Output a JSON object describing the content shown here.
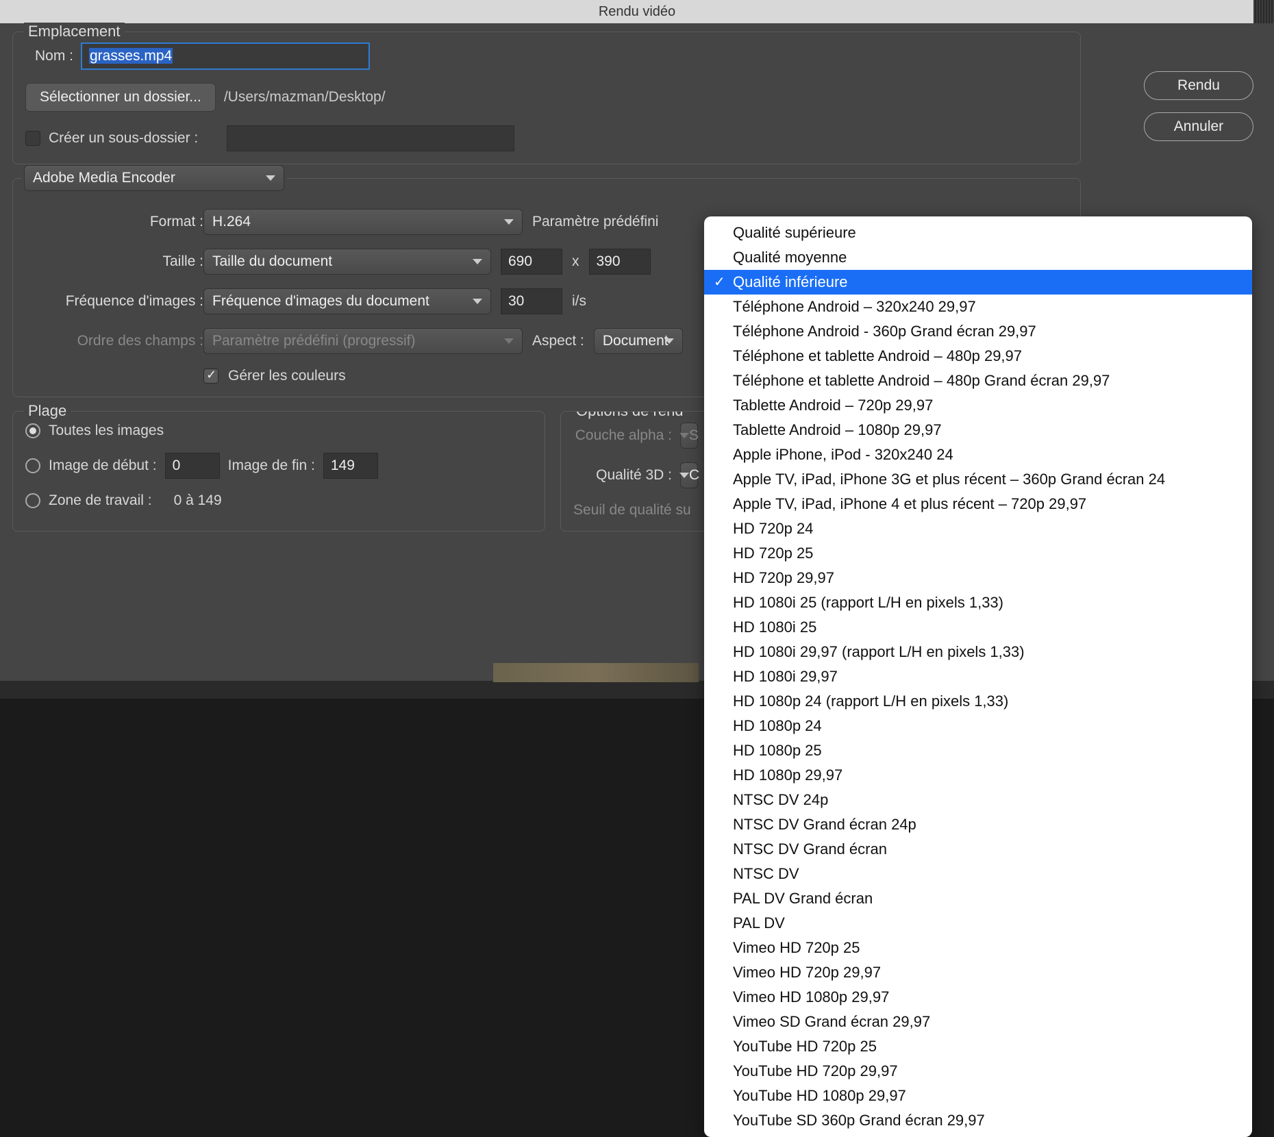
{
  "titlebar": "Rendu vidéo",
  "buttons": {
    "render": "Rendu",
    "cancel": "Annuler"
  },
  "location": {
    "legend": "Emplacement",
    "name_label": "Nom :",
    "name_value": "grasses.mp4",
    "select_folder": "Sélectionner un dossier...",
    "path": "/Users/mazman/Desktop/",
    "create_subfolder": "Créer un sous-dossier :",
    "subfolder_value": ""
  },
  "encoder": {
    "selected": "Adobe Media Encoder",
    "format_label": "Format :",
    "format_value": "H.264",
    "preset_label": "Paramètre prédéfini",
    "size_label": "Taille :",
    "size_select": "Taille du document",
    "width": "690",
    "x": "x",
    "height": "390",
    "fps_label": "Fréquence d'images :",
    "fps_select": "Fréquence d'images du document",
    "fps_value": "30",
    "fps_unit": "i/s",
    "fieldorder_label": "Ordre des champs :",
    "fieldorder_value": "Paramètre prédéfini (progressif)",
    "aspect_label": "Aspect :",
    "aspect_value": "Document",
    "manage_colors": "Gérer les couleurs"
  },
  "range": {
    "legend": "Plage",
    "all_frames": "Toutes les images",
    "start_label": "Image de début :",
    "start_value": "0",
    "end_label": "Image de fin :",
    "end_value": "149",
    "workarea_label": "Zone de travail :",
    "workarea_value": "0 à 149"
  },
  "render_options": {
    "legend": "Options de rend",
    "alpha_label": "Couche alpha :",
    "alpha_value_first": "S",
    "quality3d_label": "Qualité 3D :",
    "quality3d_value_first": "C",
    "threshold_label": "Seuil de qualité su"
  },
  "preset_menu": {
    "selected_index": 2,
    "items": [
      "Qualité supérieure",
      "Qualité moyenne",
      "Qualité inférieure",
      "Téléphone Android – 320x240 29,97",
      "Téléphone Android - 360p Grand écran 29,97",
      "Téléphone et tablette Android – 480p 29,97",
      "Téléphone et tablette Android – 480p Grand écran 29,97",
      "Tablette Android – 720p 29,97",
      "Tablette Android – 1080p 29,97",
      "Apple iPhone, iPod - 320x240 24",
      "Apple TV, iPad, iPhone 3G et plus récent – 360p Grand écran 24",
      "Apple TV, iPad, iPhone 4 et plus récent – 720p 29,97",
      "HD 720p 24",
      "HD 720p 25",
      "HD 720p 29,97",
      "HD 1080i 25 (rapport L/H en pixels 1,33)",
      "HD 1080i 25",
      "HD 1080i 29,97 (rapport L/H en pixels 1,33)",
      "HD 1080i 29,97",
      "HD 1080p 24 (rapport L/H en pixels 1,33)",
      "HD 1080p 24",
      "HD 1080p 25",
      "HD 1080p 29,97",
      "NTSC DV 24p",
      "NTSC DV Grand écran 24p",
      "NTSC DV Grand écran",
      "NTSC DV",
      "PAL DV Grand écran",
      "PAL DV",
      "Vimeo HD 720p 25",
      "Vimeo HD 720p 29,97",
      "Vimeo HD 1080p 29,97",
      "Vimeo SD Grand écran 29,97",
      "YouTube HD 720p 25",
      "YouTube HD 720p 29,97",
      "YouTube HD 1080p 29,97",
      "YouTube SD 360p Grand écran 29,97"
    ]
  }
}
